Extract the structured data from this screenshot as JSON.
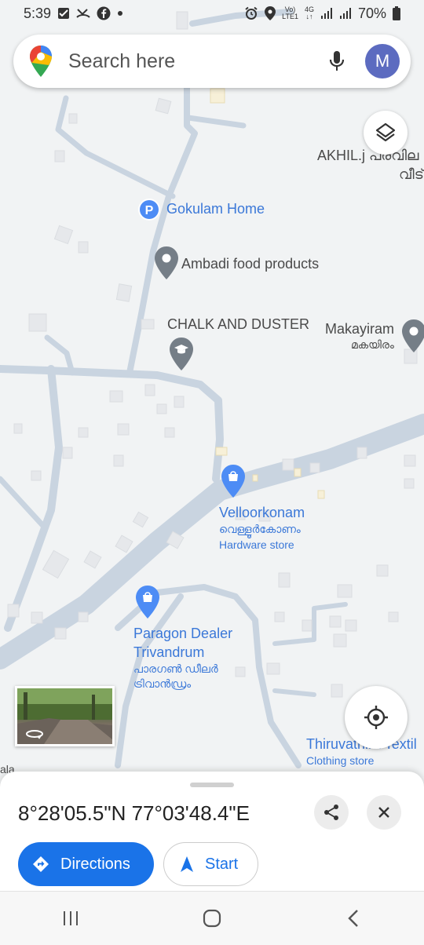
{
  "status_bar": {
    "time": "5:39",
    "network_top": "Vo)",
    "network_bottom": "LTE1",
    "gen": "4G",
    "battery": "70%"
  },
  "search": {
    "placeholder": "Search here",
    "avatar_letter": "M"
  },
  "map_labels": {
    "akhil_line1": "AKHIL.j പരവില",
    "akhil_line2": "വീട്",
    "gokulam": "Gokulam Home",
    "ambadi": "Ambadi food products",
    "chalk": "CHALK AND DUSTER",
    "makayiram": "Makayiram",
    "makayiram_ml": "മകയിരം",
    "velloorkonam": "Velloorkonam",
    "velloorkonam_ml": "വെള്ളൂർകോണം",
    "velloorkonam_type": "Hardware store",
    "paragon_line1": "Paragon Dealer",
    "paragon_line2": "Trivandrum",
    "paragon_ml1": "പാരഗൺ ഡീലർ",
    "paragon_ml2": "ട്രിവാൻഡ്രം",
    "thiruvathira": "Thiruvathira Textil",
    "thiruvathira_type": "Clothing store",
    "edge_label": "ala"
  },
  "sheet": {
    "coordinates": "8°28'05.5\"N 77°03'48.4\"E",
    "directions_label": "Directions",
    "start_label": "Start"
  },
  "colors": {
    "map_bg": "#f1f3f4",
    "road": "#c9d4e0",
    "accent_blue": "#1a73e8",
    "pin_gray": "#757e87",
    "pin_blue": "#4d8cf5"
  }
}
